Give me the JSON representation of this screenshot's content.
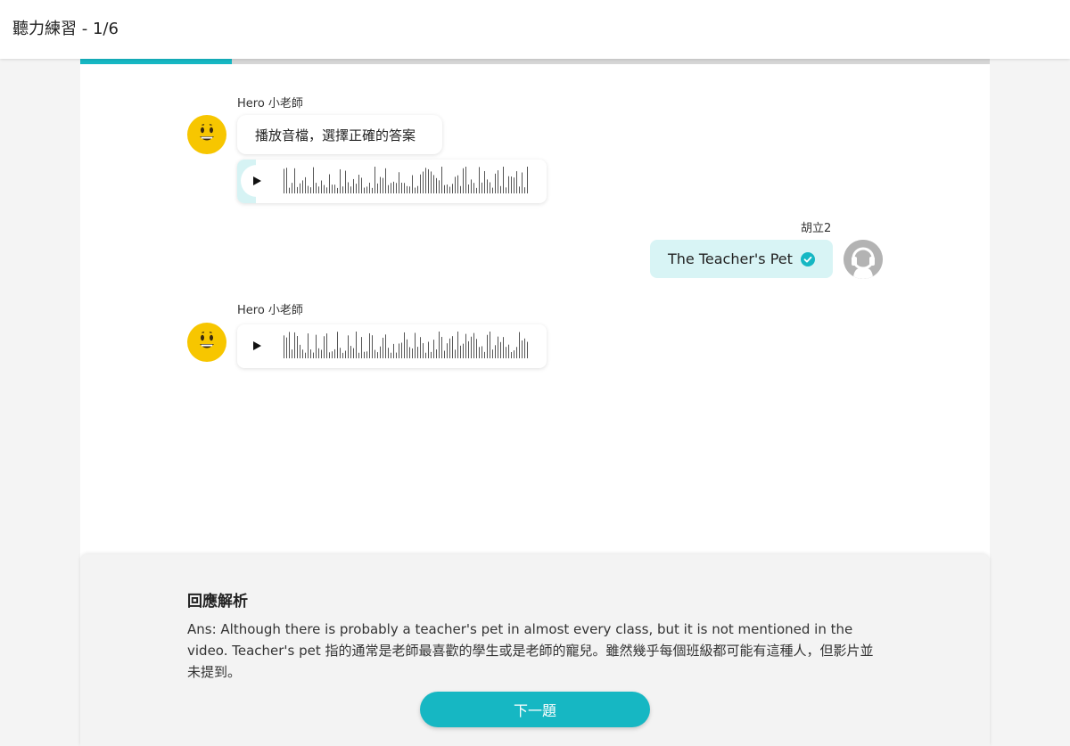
{
  "header": {
    "title": "聽力練習 - 1/6"
  },
  "progress": {
    "current": 1,
    "total": 6,
    "fraction": 0.1667,
    "color": "#16b7c3"
  },
  "conversation": {
    "teacher_name": "Hero 小老師",
    "teacher_avatar_icon": "smiley-emoji-icon",
    "instruction": "播放音檔，選擇正確的答案",
    "user_name": "胡立2",
    "user_answer": "The Teacher's Pet",
    "answer_status_icon": "check-circle-icon",
    "first_audio_progress": 0.06
  },
  "feedback": {
    "title": "回應解析",
    "body": "Ans: Although there is probably a teacher's pet in almost every class, but it is not mentioned in the video. Teacher's pet 指的通常是老師最喜歡的學生或是老師的寵兒。雖然幾乎每個班級都可能有這種人，但影片並未提到。",
    "next_button": "下一題"
  },
  "colors": {
    "accent": "#16b7c3",
    "answer_bubble": "#d8f4f5",
    "avatar_yellow": "#f7c600"
  }
}
